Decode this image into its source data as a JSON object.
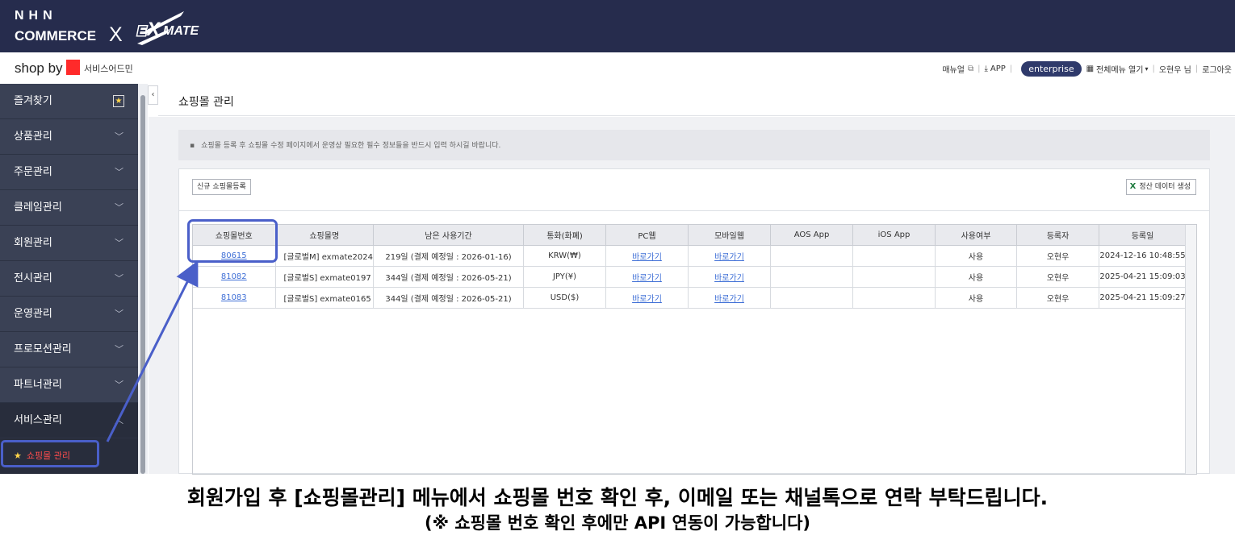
{
  "banner": {
    "nhn": "NHN",
    "commerce": "COMMERCE",
    "x": "X",
    "partner_logo": "EXMATE"
  },
  "subheader": {
    "brand": "shop by",
    "service_admin": "서비스어드민",
    "links": {
      "manual": "매뉴얼",
      "app": "APP",
      "enterprise": "enterprise",
      "all_menu": "전체메뉴 열기",
      "user": "오현우 님",
      "logout": "로그아웃"
    }
  },
  "sidebar": {
    "favorites": "즐겨찾기",
    "items": [
      "상품관리",
      "주문관리",
      "클레임관리",
      "회원관리",
      "전시관리",
      "운영관리",
      "프로모션관리",
      "파트너관리"
    ],
    "open_item": "서비스관리",
    "active_sub": "쇼핑몰 관리"
  },
  "page": {
    "title": "쇼핑몰 관리",
    "notice": "쇼핑몰 등록 후 쇼핑몰 수정 페이지에서 운영상 필요한 필수 정보들을 반드시 입력 하시길 바랍니다.",
    "btn_new": "신규 쇼핑몰등록",
    "btn_excel": "정산 데이터 생성"
  },
  "table": {
    "headers": [
      "쇼핑몰번호",
      "쇼핑몰명",
      "남은 사용기간",
      "통화(화폐)",
      "PC웹",
      "모바일웹",
      "AOS App",
      "iOS App",
      "사용여부",
      "등록자",
      "등록일"
    ],
    "rows": [
      [
        "80615",
        "[글로벌M] exmate2024",
        "219일 (결제 예정일 : 2026-01-16)",
        "KRW(₩)",
        "바로가기",
        "바로가기",
        "",
        "",
        "사용",
        "오현우",
        "2024-12-16 10:48:55"
      ],
      [
        "81082",
        "[글로벌S] exmate0197",
        "344일 (결제 예정일 : 2026-05-21)",
        "JPY(¥)",
        "바로가기",
        "바로가기",
        "",
        "",
        "사용",
        "오현우",
        "2025-04-21 15:09:03"
      ],
      [
        "81083",
        "[글로벌S] exmate0165",
        "344일 (결제 예정일 : 2026-05-21)",
        "USD($)",
        "바로가기",
        "바로가기",
        "",
        "",
        "사용",
        "오현우",
        "2025-04-21 15:09:27"
      ]
    ]
  },
  "caption": {
    "line1": "회원가입 후 [쇼핑몰관리] 메뉴에서 쇼핑몰 번호 확인 후, 이메일 또는 채널톡으로 연락 부탁드립니다.",
    "line2": "(※ 쇼핑몰 번호 확인 후에만 API 연동이 가능합니다)"
  },
  "colors": {
    "banner_bg": "#262c4d",
    "sidebar_bg": "#3a4155",
    "annotation": "#4a5fc9",
    "active_menu": "#ff4d4d",
    "link": "#3f6fd6"
  }
}
